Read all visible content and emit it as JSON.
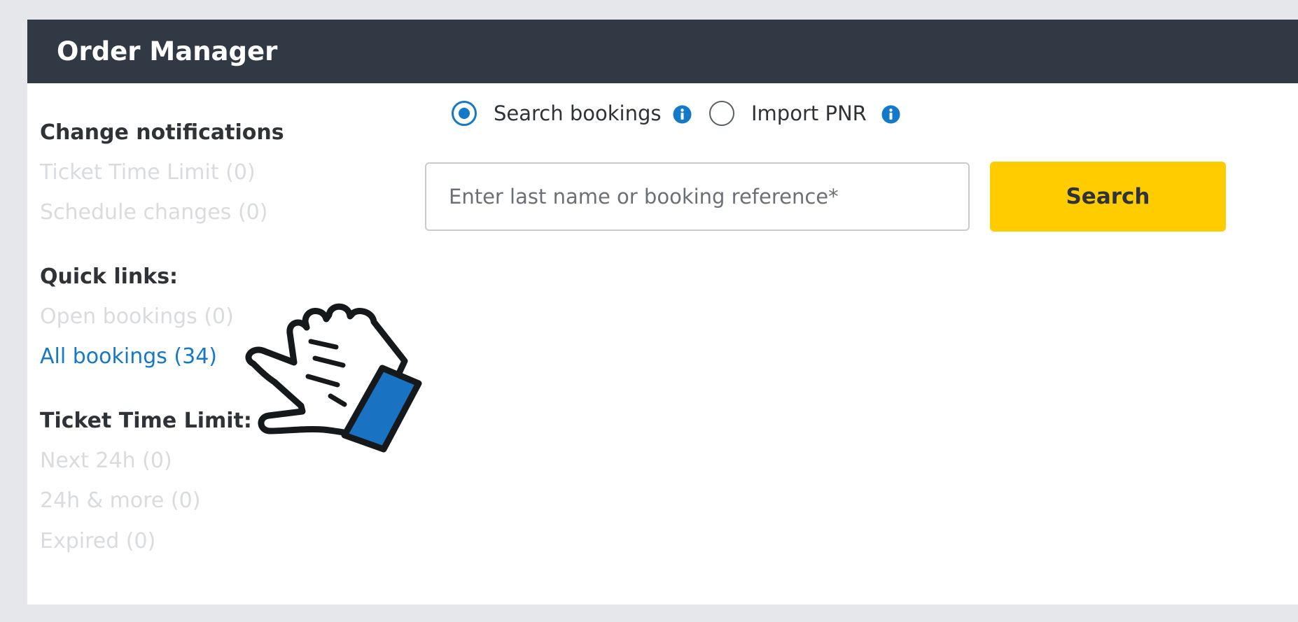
{
  "header": {
    "title": "Order Manager"
  },
  "sidebar": {
    "change_notifications": {
      "heading": "Change notifications",
      "items": [
        {
          "label": "Ticket Time Limit (0)"
        },
        {
          "label": "Schedule changes (0)"
        }
      ]
    },
    "quick_links": {
      "heading": "Quick links:",
      "items": [
        {
          "label": "Open bookings (0)",
          "active": false
        },
        {
          "label": "All bookings (34)",
          "active": true
        }
      ]
    },
    "ticket_time_limit": {
      "heading": "Ticket Time Limit:",
      "items": [
        {
          "label": "Next 24h (0)"
        },
        {
          "label": "24h & more (0)"
        },
        {
          "label": "Expired (0)"
        }
      ]
    }
  },
  "search": {
    "mode_options": [
      {
        "label": "Search bookings",
        "selected": true,
        "icon": "info-icon"
      },
      {
        "label": "Import PNR",
        "selected": false,
        "icon": "info-icon"
      }
    ],
    "input": {
      "value": "",
      "placeholder": "Enter last name or booking reference*"
    },
    "button_label": "Search"
  },
  "overlay": {
    "icon": "pointing-hand-icon"
  },
  "colors": {
    "header_bg": "#313a44",
    "accent_blue": "#1479c8",
    "button_yellow": "#ffcc00",
    "muted_link": "#d9dbdf",
    "page_bg": "#e6e7ea"
  }
}
